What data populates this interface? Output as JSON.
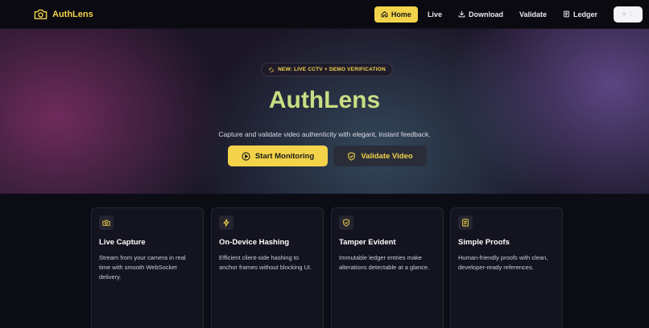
{
  "brand": {
    "name": "AuthLens",
    "icon": "camera-icon",
    "accent": "#f3d34a"
  },
  "nav": {
    "items": [
      {
        "label": "Home",
        "icon": "home-icon",
        "active": true
      },
      {
        "label": "Live",
        "icon": "",
        "active": false
      },
      {
        "label": "Download",
        "icon": "download-icon",
        "active": false
      },
      {
        "label": "Validate",
        "icon": "",
        "active": false
      },
      {
        "label": "Ledger",
        "icon": "ledger-icon",
        "active": false
      }
    ],
    "theme_toggle": {
      "icons": [
        "sun-icon",
        "moon-icon"
      ]
    }
  },
  "hero": {
    "badge": "NEW: LIVE CCTV + DEMO VERIFICATION",
    "title": "AuthLens",
    "subtitle": "Capture and validate video authenticity with elegant, instant feedback.",
    "primary_button": "Start Monitoring",
    "secondary_button": "Validate Video",
    "title_color": "#c9dd84"
  },
  "features": [
    {
      "icon": "camera-icon",
      "title": "Live Capture",
      "description": "Stream from your camera in real time with smooth WebSocket delivery."
    },
    {
      "icon": "bolt-icon",
      "title": "On-Device Hashing",
      "description": "Efficient client-side hashing to anchor frames without blocking UI."
    },
    {
      "icon": "shield-check-icon",
      "title": "Tamper Evident",
      "description": "Immutable ledger entries make alterations detectable at a glance."
    },
    {
      "icon": "document-icon",
      "title": "Simple Proofs",
      "description": "Human-friendly proofs with clean, developer-ready references."
    }
  ]
}
